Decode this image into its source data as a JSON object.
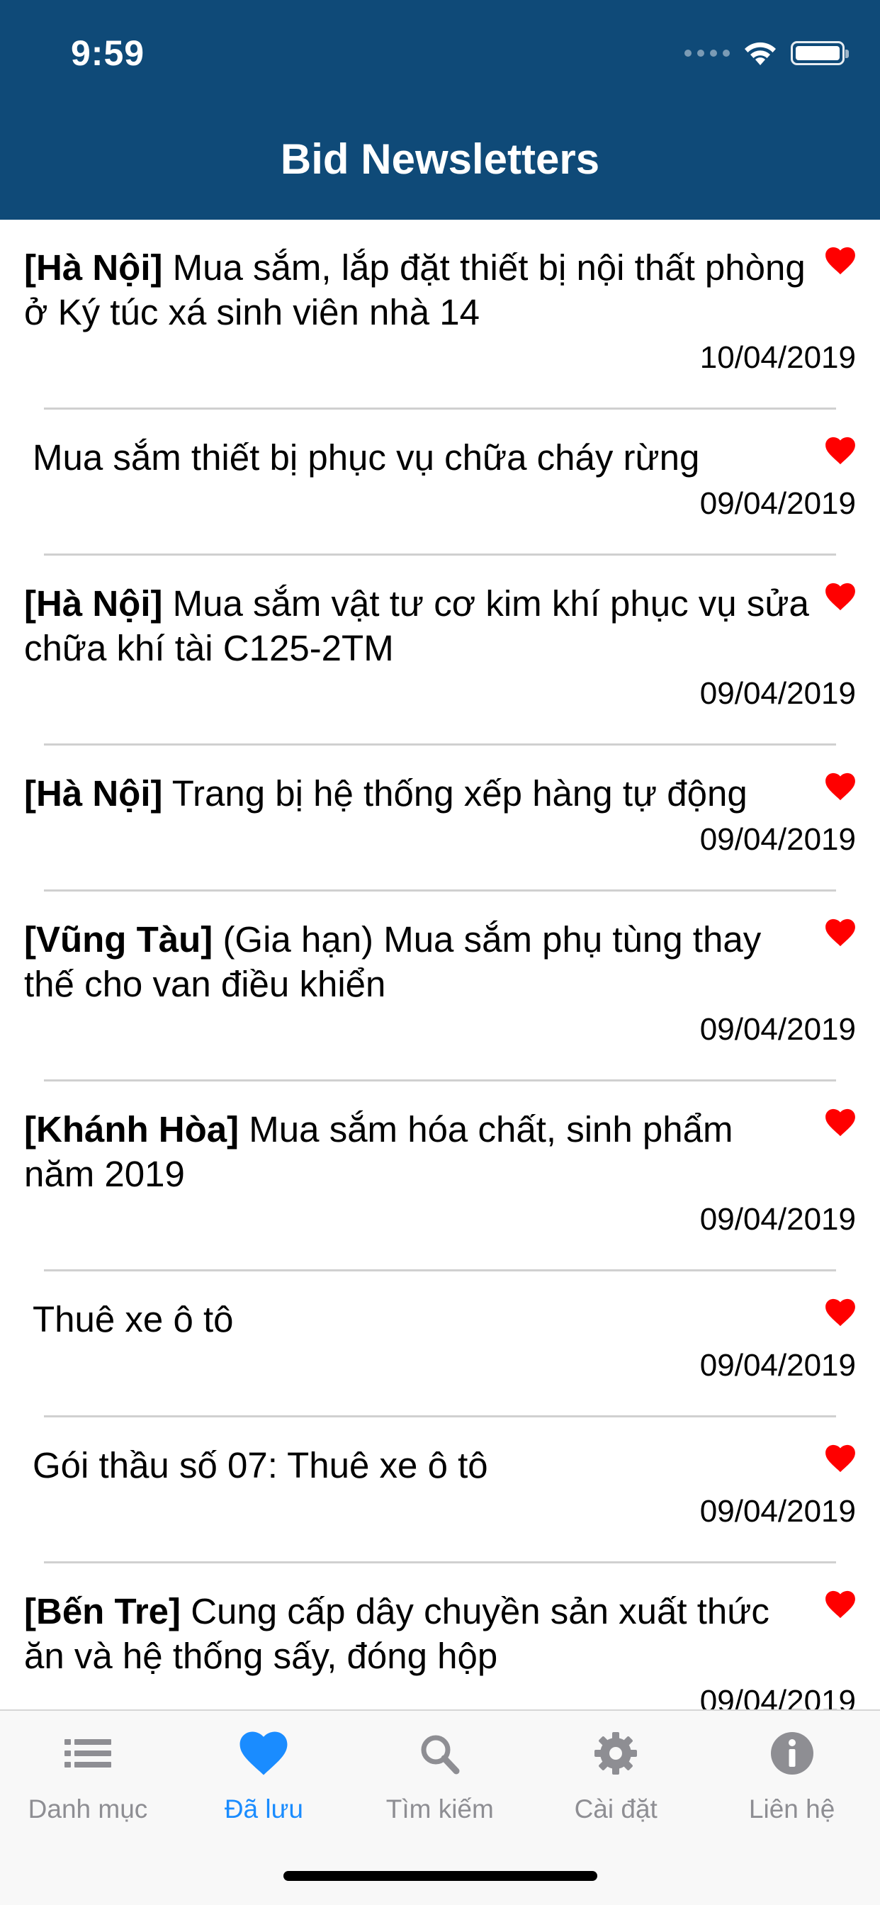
{
  "status_bar": {
    "time": "9:59"
  },
  "nav": {
    "title": "Bid Newsletters"
  },
  "colors": {
    "header_bg": "#0f4a78",
    "heart": "#ff0000",
    "tab_active": "#1a8cff",
    "tab_inactive": "#8e8e93"
  },
  "items": [
    {
      "prefix": "[Hà Nội]",
      "title": " Mua sắm, lắp đặt thiết bị nội thất phòng ở Ký túc xá sinh viên nhà 14",
      "date": "10/04/2019"
    },
    {
      "prefix": "",
      "title": " Mua sắm thiết bị phục vụ chữa cháy rừng",
      "date": "09/04/2019"
    },
    {
      "prefix": "[Hà Nội]",
      "title": " Mua sắm vật tư cơ kim khí phục vụ sửa chữa khí tài C125-2TM",
      "date": "09/04/2019"
    },
    {
      "prefix": "[Hà Nội]",
      "title": " Trang bị hệ thống xếp hàng tự động",
      "date": "09/04/2019"
    },
    {
      "prefix": "[Vũng Tàu]",
      "title": " (Gia hạn) Mua sắm phụ tùng thay thế cho van điều khiển",
      "date": "09/04/2019"
    },
    {
      "prefix": "[Khánh Hòa]",
      "title": " Mua sắm hóa chất, sinh phẩm năm 2019",
      "date": "09/04/2019"
    },
    {
      "prefix": "",
      "title": " Thuê xe ô tô",
      "date": "09/04/2019"
    },
    {
      "prefix": "",
      "title": " Gói thầu số 07: Thuê xe ô tô",
      "date": "09/04/2019"
    },
    {
      "prefix": "[Bến Tre]",
      "title": " Cung cấp dây chuyền sản xuất thức ăn và hệ thống sấy, đóng hộp",
      "date": "09/04/2019"
    }
  ],
  "tabs": [
    {
      "label": "Danh mục",
      "icon": "list-icon"
    },
    {
      "label": "Đã lưu",
      "icon": "heart-icon",
      "active": true
    },
    {
      "label": "Tìm kiếm",
      "icon": "search-icon"
    },
    {
      "label": "Cài đặt",
      "icon": "gear-icon"
    },
    {
      "label": "Liên hệ",
      "icon": "info-icon"
    }
  ]
}
